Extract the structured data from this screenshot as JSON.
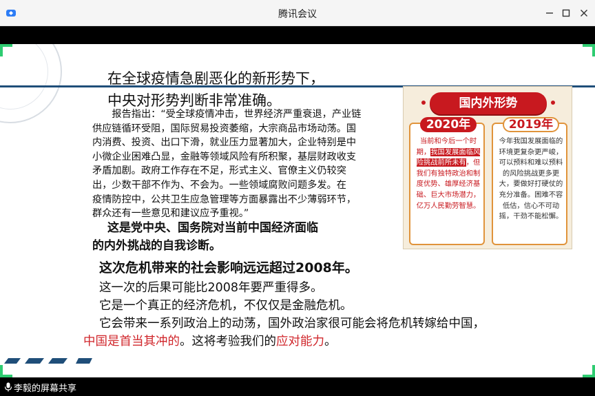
{
  "window": {
    "title": "腾讯会议"
  },
  "slide": {
    "heading_line1": "在全球疫情急剧恶化的新形势下，",
    "heading_line2": "中央对形势判断非常准确。",
    "report_lines": [
      "　　报告指出：“受全球疫情冲击，世界经济严重衰退，产业链",
      "供应链循环受阻，国际贸易投资萎缩，大宗商品市场动荡。国",
      "内消费、投资、出口下滑，就业压力显著加大，企业特别是中",
      "小微企业困难凸显，金融等领域风险有所积聚，基层财政收支",
      "矛盾加剧。政府工作存在不足，形式主义、官僚主义仍较突",
      "出，少数干部不作为、不会为。一些领域腐败问题多发。在",
      "疫情防控中，公共卫生应急管理等方面暴露出不少薄弱环节，",
      "群众还有一些意见和建议应予重视。”"
    ],
    "bold_line1": "这是党中央、国务院对当前中国经济面临",
    "bold_line2": "的内外挑战的自我诊断。",
    "bold_line3": "这次危机带来的社会影响远远超过2008年。",
    "line1": "这一次的后果可能比2008年要严重得多。",
    "line2": "它是一个真正的经济危机，不仅仅是金融危机。",
    "line3": "它会带来一系列政治上的动荡，国外政治家很可能会将危机转嫁给中国，",
    "line4_red1": "中国是首当其冲的",
    "line4_mid": "。这将考验我们的",
    "line4_red2": "应对能力",
    "line4_end": "。",
    "infographic": {
      "banner": "国内外形势",
      "left_year": "2020年",
      "left_pre": "当前和今后一个时期，",
      "left_hl": "我国发展面临风险挑战前所未有",
      "left_post": "，但我们有独特政治和制度优势、雄厚经济基础、巨大市场潜力，亿万人民勤劳智慧。",
      "right_year": "2019年",
      "right_text": "今年我国发展面临的环境更复杂更严峻，可以预料和难以预料的风险挑战更多更大，要做好打硬仗的充分准备。困难不容低估，信心不可动摇，干劲不能松懈。"
    }
  },
  "bottombar": {
    "share_label": "李毅的屏幕共享"
  },
  "colors": {
    "accent_green": "#2ecc71",
    "highlight_red": "#d0262b",
    "slide_line_blue": "#1f4e79"
  },
  "icons": [
    "app-icon",
    "minimize-icon",
    "maximize-icon",
    "close-icon",
    "microphone-icon"
  ]
}
